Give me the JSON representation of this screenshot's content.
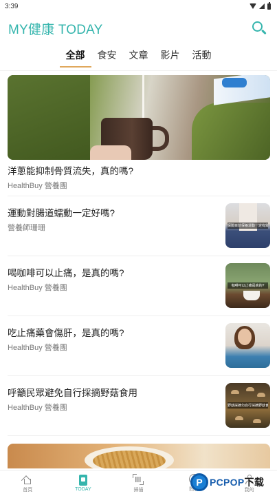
{
  "status_bar": {
    "time": "3:39"
  },
  "header": {
    "title": "MY健康 TODAY"
  },
  "tabs": [
    {
      "label": "全部",
      "active": true
    },
    {
      "label": "食安",
      "active": false
    },
    {
      "label": "文章",
      "active": false
    },
    {
      "label": "影片",
      "active": false
    },
    {
      "label": "活動",
      "active": false
    }
  ],
  "hero": {
    "title": "洋蔥能抑制骨質流失，真的嗎?",
    "source": "HealthBuy 營養團"
  },
  "articles": [
    {
      "title": "運動對腸道蠕動一定好嗎?",
      "source": "營養師珊珊",
      "thumb_caption": "保險目前保養運動一定有效?"
    },
    {
      "title": "喝咖啡可以止痛，是真的嗎?",
      "source": "HealthBuy 營養團",
      "thumb_caption": "咖啡可以止痛是真的?"
    },
    {
      "title": "吃止痛藥會傷肝，是真的嗎?",
      "source": "HealthBuy 營養團",
      "thumb_caption": ""
    },
    {
      "title": "呼籲民眾避免自行採摘野菇食用",
      "source": "HealthBuy 營養團",
      "thumb_caption": "野菇採摘勿自行採摘野菇食用"
    }
  ],
  "bottom_nav": [
    {
      "label": "首頁",
      "icon": "home-icon",
      "active": false
    },
    {
      "label": "TODAY",
      "icon": "today-icon",
      "active": true
    },
    {
      "label": "掃描",
      "icon": "scan-icon",
      "active": false
    },
    {
      "label": "問答",
      "icon": "chat-icon",
      "active": false
    },
    {
      "label": "我的",
      "icon": "profile-icon",
      "active": false
    }
  ],
  "watermark": {
    "badge": "P",
    "text_main": "PCPOP",
    "text_accent": "下载"
  },
  "colors": {
    "accent": "#35b5ad",
    "tab_underline": "#e0a85c"
  }
}
